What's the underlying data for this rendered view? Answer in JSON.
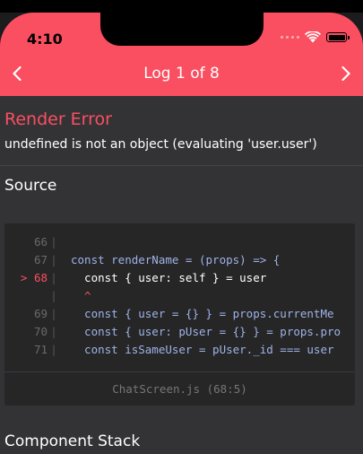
{
  "status_bar": {
    "time": "4:10"
  },
  "nav": {
    "title": "Log 1 of 8",
    "prev_icon": "chevron-left-icon",
    "next_icon": "chevron-right-icon"
  },
  "error": {
    "title": "Render Error",
    "message": "undefined is not an object (evaluating 'user.user')"
  },
  "source": {
    "heading": "Source",
    "lines": [
      {
        "num": "66",
        "code": "",
        "active": false
      },
      {
        "num": "67",
        "code": "const renderName = (props) => {",
        "active": false
      },
      {
        "num": "> 68",
        "code": "  const { user: self } = user",
        "active": true
      },
      {
        "num": "",
        "code": "  ^",
        "active": false,
        "caret": true
      },
      {
        "num": "69",
        "code": "  const { user = {} } = props.currentMe",
        "active": false
      },
      {
        "num": "70",
        "code": "  const { user: pUser = {} } = props.pro",
        "active": false
      },
      {
        "num": "71",
        "code": "  const isSameUser = pUser._id === user",
        "active": false
      }
    ],
    "file": "ChatScreen.js (68:5)"
  },
  "component_stack": {
    "heading": "Component Stack"
  },
  "colors": {
    "accent": "#fa4f61",
    "background": "#333335",
    "code_bg": "#262627"
  }
}
